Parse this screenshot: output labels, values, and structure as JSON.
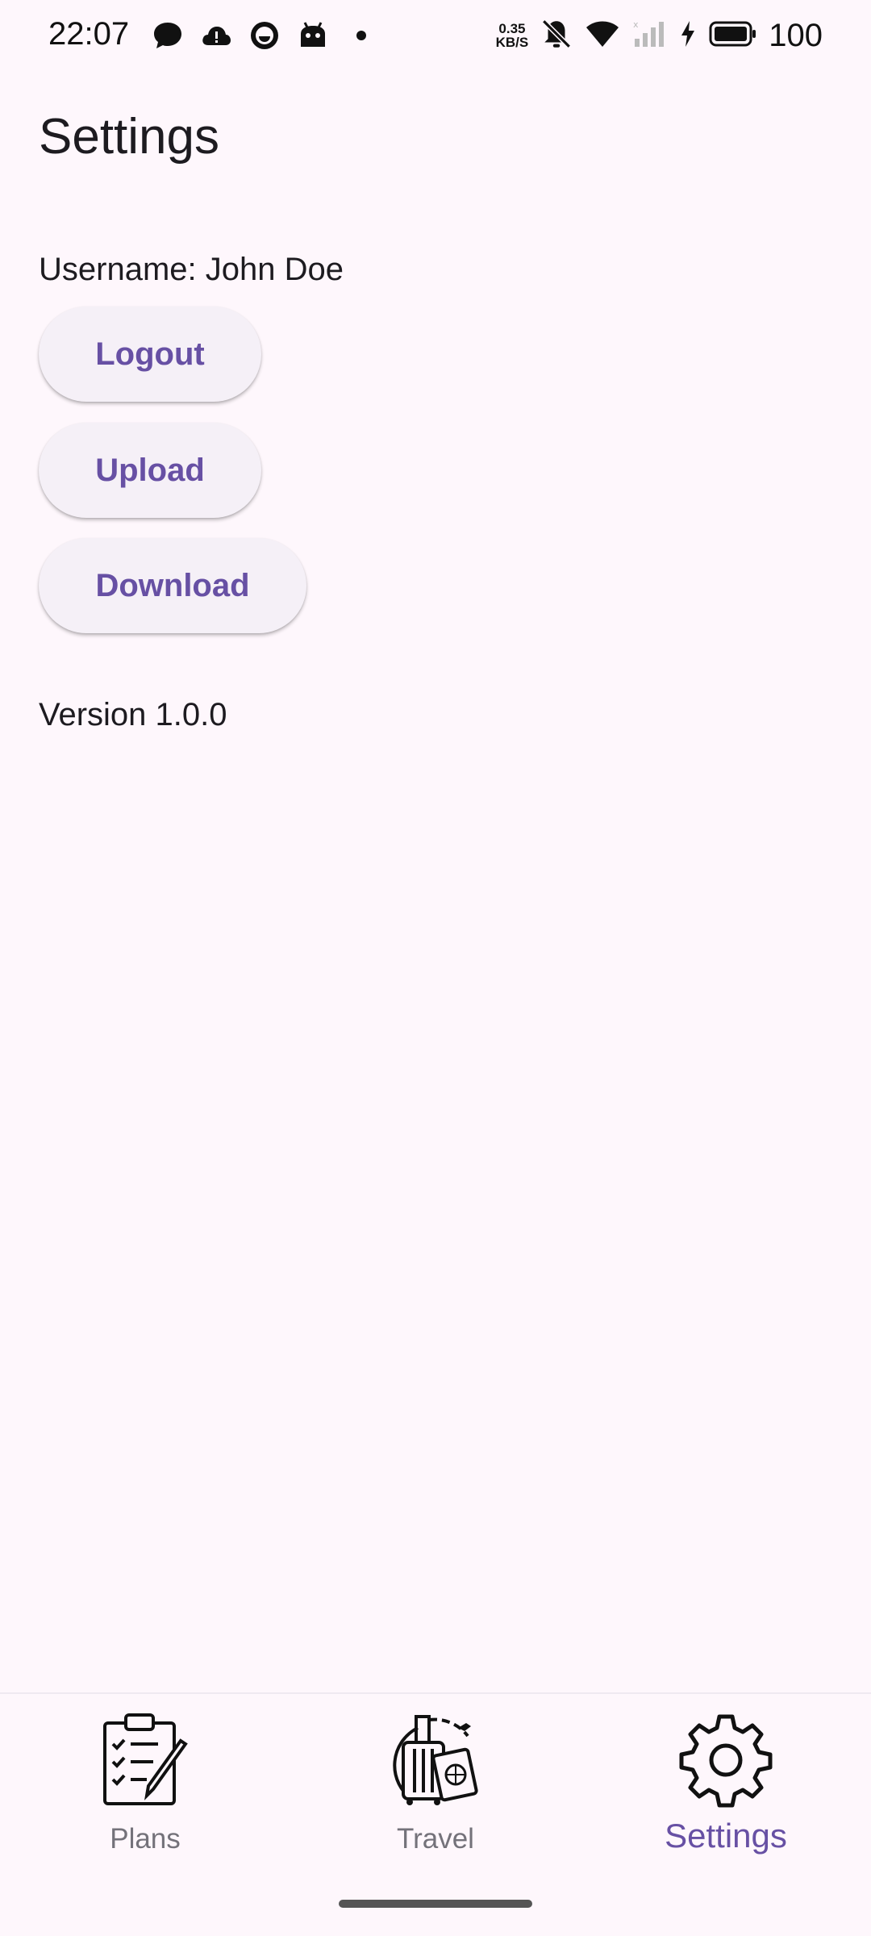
{
  "status_bar": {
    "time": "22:07",
    "net_speed_value": "0.35",
    "net_speed_unit": "KB/S",
    "battery": "100",
    "icons": [
      "chat-bubble-icon",
      "cloud-alert-icon",
      "water-drop-icon",
      "android-icon",
      "notification-dot-icon",
      "mute-icon",
      "wifi-icon",
      "cellular-signal-icon",
      "charging-icon",
      "battery-icon"
    ]
  },
  "page": {
    "title": "Settings",
    "username": "Username: John Doe",
    "version": "Version 1.0.0"
  },
  "buttons": {
    "logout": "Logout",
    "upload": "Upload",
    "download": "Download"
  },
  "bottom_nav": {
    "items": [
      {
        "label": "Plans",
        "icon": "clipboard-checklist-icon",
        "active": false
      },
      {
        "label": "Travel",
        "icon": "luggage-passport-icon",
        "active": false
      },
      {
        "label": "Settings",
        "icon": "gear-icon",
        "active": true
      }
    ]
  },
  "colors": {
    "background": "#fef7fc",
    "accent": "#6750a4",
    "button_bg": "#f5f0f7",
    "inactive_label": "#74727a"
  }
}
